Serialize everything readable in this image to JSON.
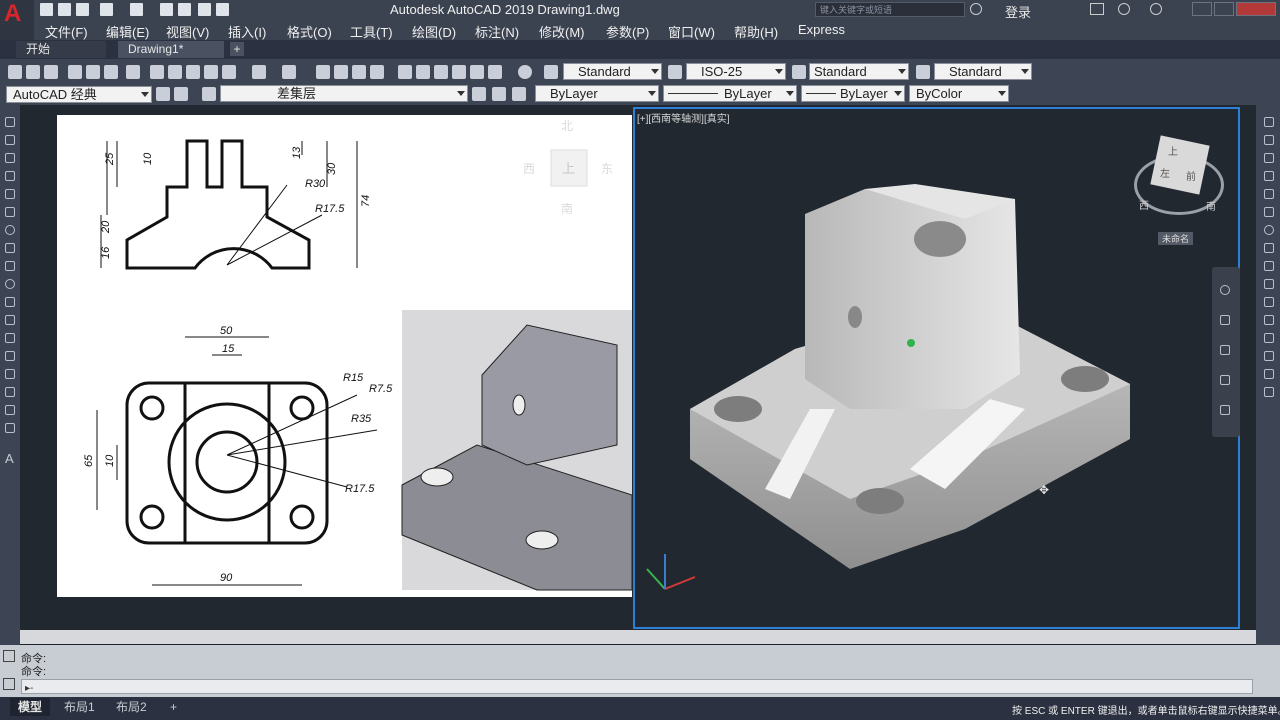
{
  "window": {
    "title": "Autodesk AutoCAD 2019    Drawing1.dwg",
    "search_placeholder": "键入关键字或短语",
    "login": "登录",
    "logo_letter": "A"
  },
  "menu": [
    "文件(F)",
    "编辑(E)",
    "视图(V)",
    "插入(I)",
    "格式(O)",
    "工具(T)",
    "绘图(D)",
    "标注(N)",
    "修改(M)",
    "参数(P)",
    "窗口(W)",
    "帮助(H)",
    "Express"
  ],
  "tabs": [
    {
      "label": "开始",
      "active": false
    },
    {
      "label": "Drawing1*",
      "active": true
    }
  ],
  "toolbar1": {
    "text_style": "Standard",
    "dim_style": "ISO-25",
    "table_style": "Standard",
    "mleader_style": "Standard"
  },
  "toolbar2": {
    "workspace": "AutoCAD 经典",
    "layer": "差集层",
    "color": "ByLayer",
    "linetype": "ByLayer",
    "lineweight": "ByLayer",
    "plotstyle": "ByColor"
  },
  "viewport": {
    "label": "[+][西南等轴测][真实]",
    "cube_north": "北",
    "cube_west": "西",
    "cube_east": "东",
    "cube_south": "南",
    "cube_face_top": "上",
    "cube_face_left": "左",
    "cube_face_front": "前",
    "cube_unnamed": "未命名"
  },
  "drawing": {
    "dims_front": [
      "25",
      "10",
      "13",
      "30",
      "R30",
      "R17.5",
      "74",
      "20",
      "16"
    ],
    "dims_top": [
      "50",
      "15",
      "R15",
      "R7.5",
      "R35",
      "65",
      "10",
      "R17.5",
      "90"
    ]
  },
  "command": {
    "line1": "命令:",
    "line2": "命令:",
    "prompt": "▸-"
  },
  "status": {
    "tabs": [
      "模型",
      "布局1",
      "布局2"
    ],
    "add_tab": "+",
    "hint": "按 ESC 或 ENTER 键退出，或者单击鼠标右键显示快捷菜单。"
  },
  "colors": {
    "title_bg": "#3b4250",
    "viewport_border": "#2e7fd6",
    "accent_red": "#d8262c",
    "background": "#212830"
  }
}
